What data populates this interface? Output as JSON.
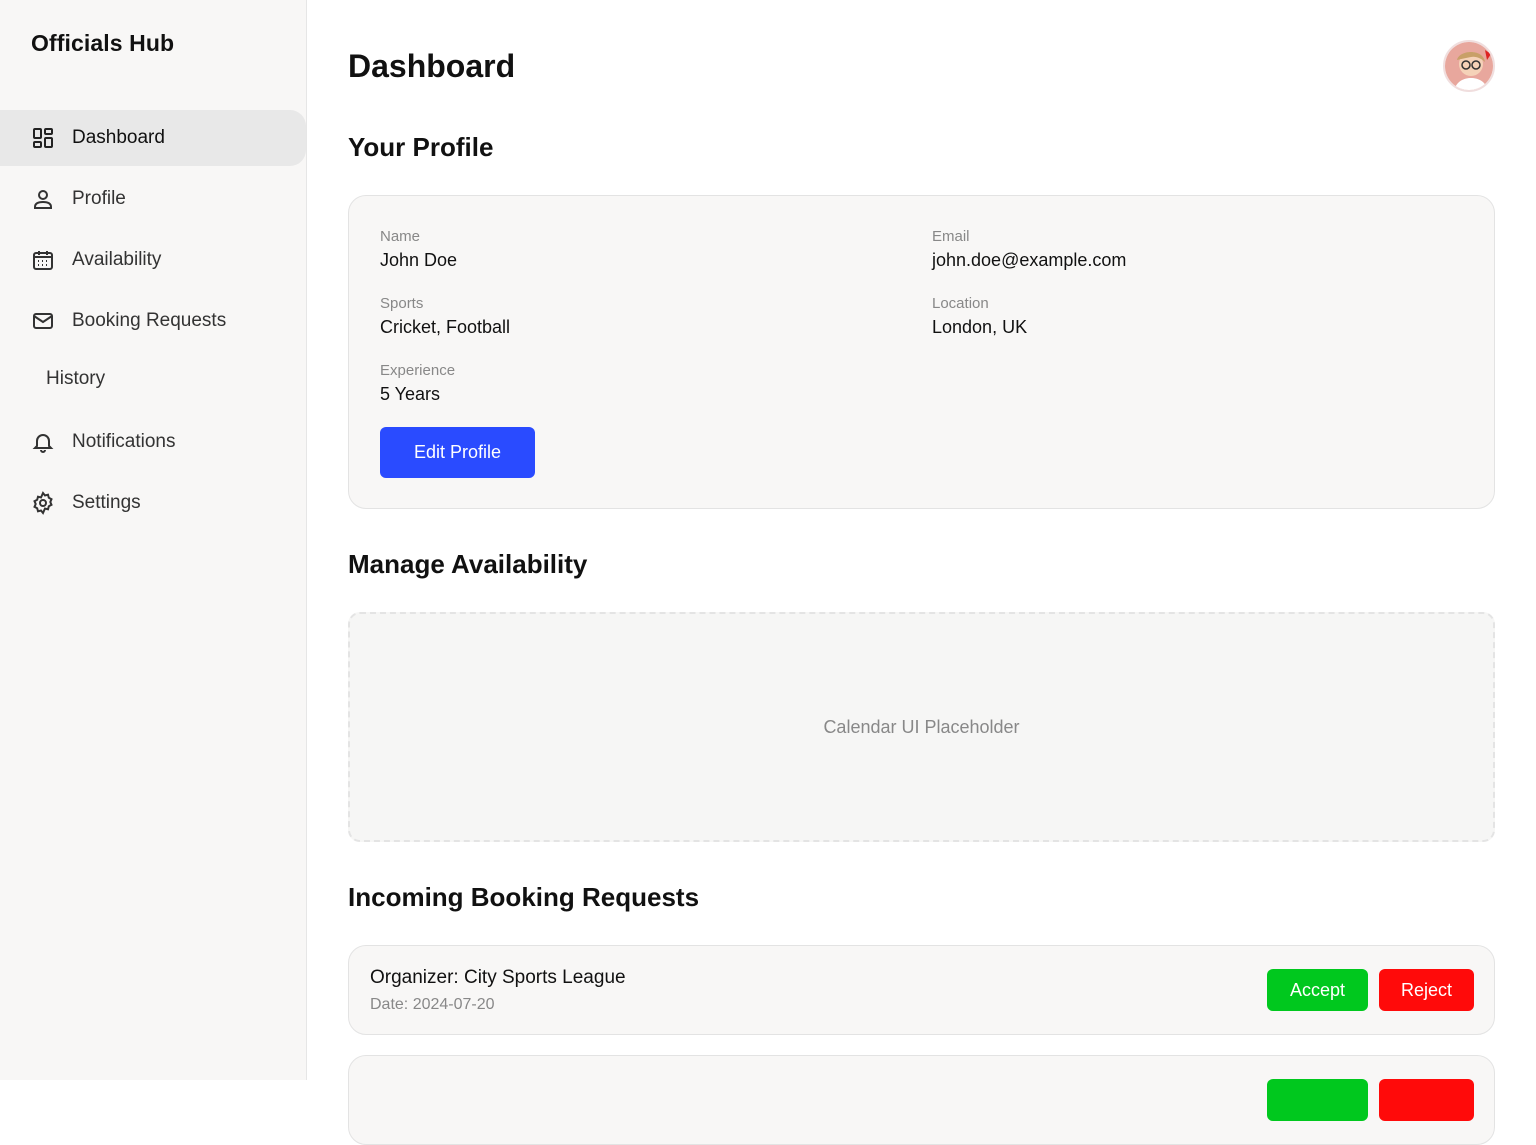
{
  "app": {
    "brand": "Officials Hub"
  },
  "sidebar": {
    "items": [
      {
        "label": "Dashboard",
        "icon": "dashboard-icon"
      },
      {
        "label": "Profile",
        "icon": "user-icon"
      },
      {
        "label": "Availability",
        "icon": "calendar-icon"
      },
      {
        "label": "Booking Requests",
        "icon": "mail-icon"
      },
      {
        "label": "History",
        "icon": ""
      },
      {
        "label": "Notifications",
        "icon": "bell-icon"
      },
      {
        "label": "Settings",
        "icon": "gear-icon"
      }
    ],
    "active_item": "Dashboard"
  },
  "header": {
    "title": "Dashboard",
    "avatar_icon": "user-avatar"
  },
  "profile": {
    "section_title": "Your Profile",
    "fields": {
      "name": {
        "label": "Name",
        "value": "John Doe"
      },
      "email": {
        "label": "Email",
        "value": "john.doe@example.com"
      },
      "sports": {
        "label": "Sports",
        "value": "Cricket, Football"
      },
      "location": {
        "label": "Location",
        "value": "London, UK"
      },
      "experience": {
        "label": "Experience",
        "value": "5 Years"
      }
    },
    "edit_button": "Edit Profile"
  },
  "availability": {
    "section_title": "Manage Availability",
    "placeholder": "Calendar UI Placeholder"
  },
  "booking_requests": {
    "section_title": "Incoming Booking Requests",
    "items": [
      {
        "organizer": "Organizer: City Sports League",
        "date": "Date: 2024-07-20",
        "accept_label": "Accept",
        "reject_label": "Reject"
      },
      {
        "organizer": "",
        "date": "",
        "accept_label": "",
        "reject_label": ""
      }
    ]
  },
  "colors": {
    "primary": "#2a4bff",
    "accept": "#00c81e",
    "reject": "#ff0a0a",
    "sidebar_bg": "#f8f7f6",
    "active_nav_bg": "#e8e8e8"
  }
}
